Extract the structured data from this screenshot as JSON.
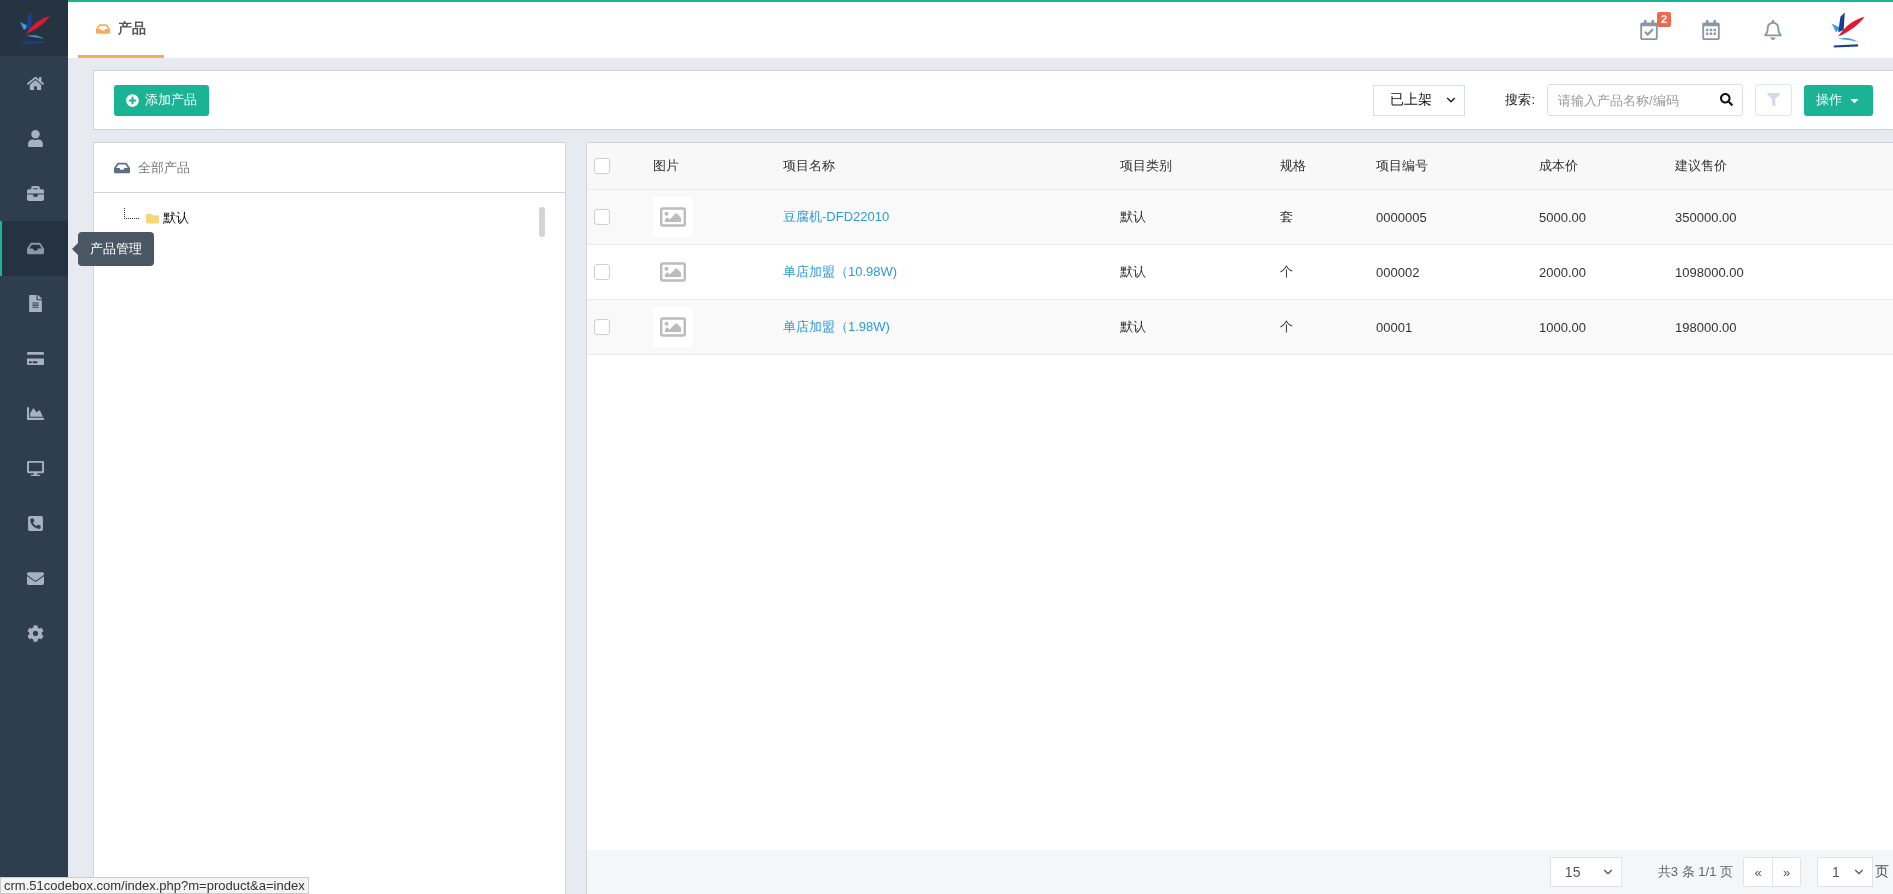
{
  "sidebar": {
    "items": [
      {
        "selected": false
      },
      {
        "selected": false
      },
      {
        "selected": false
      },
      {
        "selected": true
      },
      {
        "selected": false
      },
      {
        "selected": false
      },
      {
        "selected": false
      },
      {
        "selected": false
      },
      {
        "selected": false
      },
      {
        "selected": false
      },
      {
        "selected": false
      }
    ],
    "tooltip": "产品管理"
  },
  "header": {
    "tabs": [
      {
        "label": "产品",
        "selected": true
      }
    ],
    "task_badge": "2"
  },
  "toolbar": {
    "add_button": "添加产品",
    "status_select": "已上架",
    "search_label": "搜索:",
    "search": {
      "placeholder": "请输入产品名称/编码"
    },
    "action_button": "操作"
  },
  "tree": {
    "title": "全部产品",
    "nodes": [
      {
        "label": "默认",
        "selected": false
      }
    ]
  },
  "table": {
    "columns": [
      "图片",
      "项目名称",
      "项目类别",
      "规格",
      "项目编号",
      "成本价",
      "建议售价"
    ],
    "rows": [
      {
        "checked": false,
        "name": "豆腐机-DFD22010",
        "category": "默认",
        "unit": "套",
        "code": "0000005",
        "cost": "5000.00",
        "price": "350000.00"
      },
      {
        "checked": false,
        "name": "单店加盟（10.98W)",
        "category": "默认",
        "unit": "个",
        "code": "000002",
        "cost": "2000.00",
        "price": "1098000.00"
      },
      {
        "checked": false,
        "name": "单店加盟（1.98W)",
        "category": "默认",
        "unit": "个",
        "code": "00001",
        "cost": "1000.00",
        "price": "198000.00"
      }
    ],
    "header_checked": false
  },
  "pagination": {
    "page_size": "15",
    "info": "共3 条 1/1 页",
    "prev": "«",
    "next": "»",
    "page": "1",
    "page_suffix": "页"
  },
  "status_bar": "crm.51codebox.com/index.php?m=product&a=index"
}
